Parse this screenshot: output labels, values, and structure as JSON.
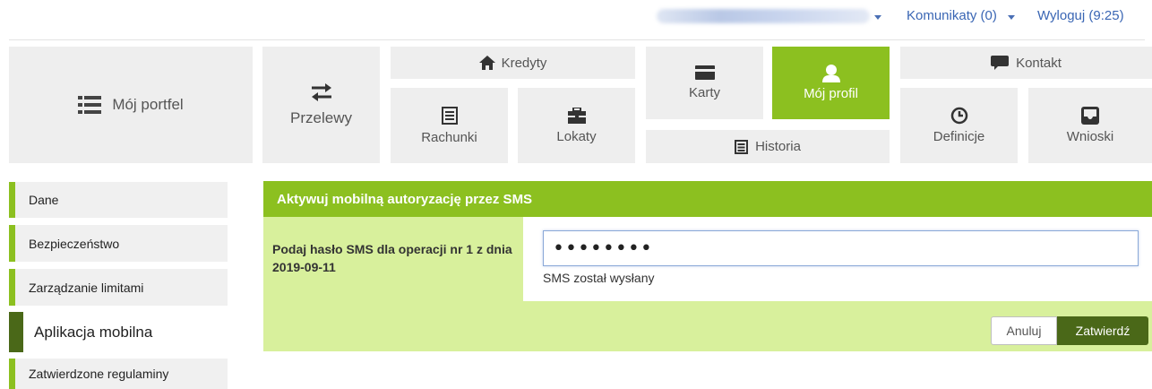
{
  "topbar": {
    "messages": "Komunikaty (0)",
    "logout": "Wyloguj (9:25)"
  },
  "nav": {
    "portfolio": "Mój portfel",
    "transfers": "Przelewy",
    "credits": "Kredyty",
    "accounts": "Rachunki",
    "deposits": "Lokaty",
    "cards": "Karty",
    "profile": "Mój profil",
    "history": "Historia",
    "contact": "Kontakt",
    "definitions": "Definicje",
    "applications": "Wnioski"
  },
  "sidebar": {
    "items": [
      {
        "label": "Dane"
      },
      {
        "label": "Bezpieczeństwo"
      },
      {
        "label": "Zarządzanie limitami"
      },
      {
        "label": "Aplikacja mobilna"
      },
      {
        "label": "Zatwierdzone regulaminy"
      }
    ],
    "active_index": 3
  },
  "panel": {
    "title": "Aktywuj mobilną autoryzację przez SMS",
    "label": "Podaj hasło SMS dla operacji nr 1 z dnia 2019-09-11",
    "input_value": "••••••••",
    "status": "SMS został wysłany",
    "cancel": "Anuluj",
    "confirm": "Zatwierdź"
  },
  "colors": {
    "accent": "#8cc020",
    "accent_dark": "#4a6818",
    "panel_bg": "#d8f09c",
    "link": "#3a66b4"
  },
  "icons": [
    "list-icon",
    "transfer-arrows-icon",
    "home-icon",
    "document-icon",
    "briefcase-icon",
    "card-icon",
    "user-icon",
    "chat-icon",
    "clock-icon",
    "inbox-icon"
  ]
}
